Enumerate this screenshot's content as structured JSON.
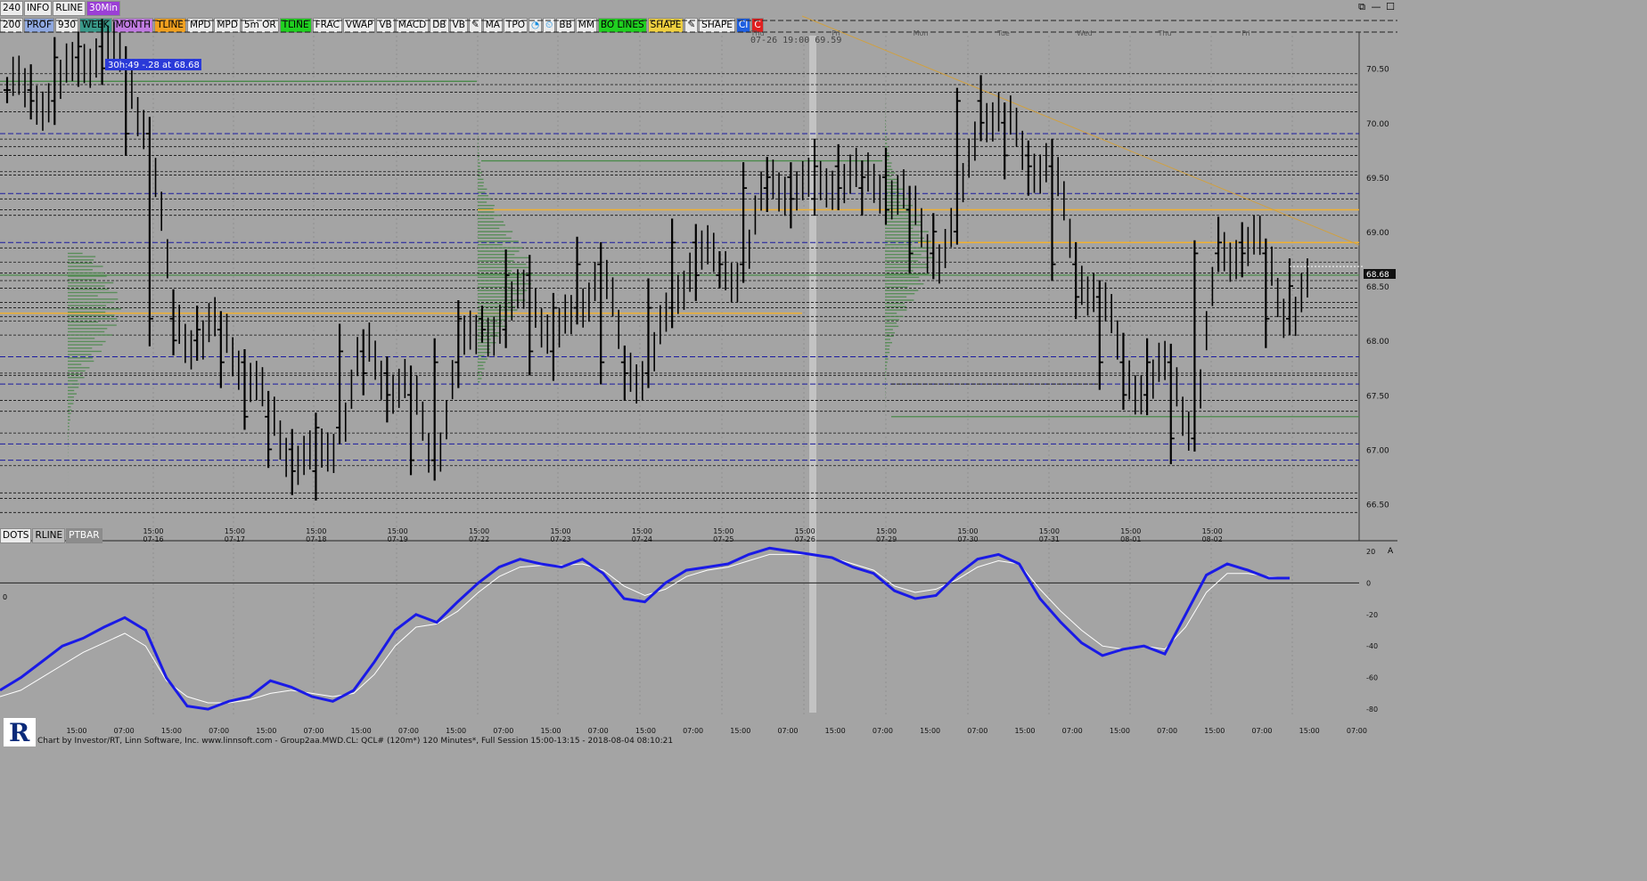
{
  "toolbar": {
    "row1": [
      {
        "label": "240",
        "bg": "#ececec",
        "fg": "#000000"
      },
      {
        "label": "INFO",
        "bg": "#ececec",
        "fg": "#000000"
      },
      {
        "label": "RLINE",
        "bg": "#ececec",
        "fg": "#000000"
      },
      {
        "label": "30Min",
        "bg": "#9b3fd6",
        "fg": "#ffffff"
      }
    ],
    "row2": [
      {
        "label": "200",
        "bg": "#ececec",
        "fg": "#000000"
      },
      {
        "label": "PROF",
        "bg": "#8fa8e0",
        "fg": "#000000"
      },
      {
        "label": "930",
        "bg": "#ececec",
        "fg": "#000000"
      },
      {
        "label": "WEEK",
        "bg": "#3a9a8a",
        "fg": "#000000"
      },
      {
        "label": "MONTH",
        "bg": "#c07be0",
        "fg": "#000000"
      },
      {
        "label": "TLINE",
        "bg": "#f0a020",
        "fg": "#000000"
      },
      {
        "label": "MPD",
        "bg": "#ececec",
        "fg": "#000000"
      },
      {
        "label": "MPD",
        "bg": "#ececec",
        "fg": "#000000"
      },
      {
        "label": "5m OR",
        "bg": "#ececec",
        "fg": "#000000"
      },
      {
        "label": "TLINE",
        "bg": "#20d020",
        "fg": "#000000"
      },
      {
        "label": "FRAC",
        "bg": "#ececec",
        "fg": "#000000"
      },
      {
        "label": "VWAP",
        "bg": "#ececec",
        "fg": "#000000"
      },
      {
        "label": "VB",
        "bg": "#ececec",
        "fg": "#000000"
      },
      {
        "label": "MACD",
        "bg": "#ececec",
        "fg": "#000000"
      },
      {
        "label": "DB",
        "bg": "#ececec",
        "fg": "#000000"
      },
      {
        "label": "VB",
        "bg": "#ececec",
        "fg": "#000000"
      },
      {
        "icon": "pencil-icon",
        "bg": "#ececec",
        "fg": "#000000"
      },
      {
        "label": "MA",
        "bg": "#ececec",
        "fg": "#000000"
      },
      {
        "label": "TPO",
        "bg": "#ececec",
        "fg": "#000000"
      },
      {
        "icon": "pie-icon",
        "bg": "#ececec",
        "fg": "#1a8fe0"
      },
      {
        "icon": "clock-icon",
        "bg": "#ececec",
        "fg": "#1a8fe0"
      },
      {
        "label": "BB",
        "bg": "#ececec",
        "fg": "#000000"
      },
      {
        "label": "MM",
        "bg": "#ececec",
        "fg": "#000000"
      },
      {
        "label": "BO LINES",
        "bg": "#20d020",
        "fg": "#000000"
      },
      {
        "label": "SHAPE",
        "bg": "#f0d040",
        "fg": "#000000"
      },
      {
        "icon": "pencil-icon",
        "bg": "#ececec",
        "fg": "#000000"
      },
      {
        "label": "SHAPE",
        "bg": "#ececec",
        "fg": "#000000"
      },
      {
        "label": "CI",
        "bg": "#2060e0",
        "fg": "#ffffff"
      },
      {
        "label": "C",
        "bg": "#e02020",
        "fg": "#ffffff"
      }
    ]
  },
  "lower_tabs": [
    "DOTS",
    "RLINE",
    "PTBAR"
  ],
  "cursor_readout": "07-26 19:00 69.59",
  "info_label": "30h:49  -.28 at 68.68",
  "last_price": "68.68",
  "weekday_labels": [
    "Thu",
    "Fri",
    "Mon",
    "Tue",
    "Wed",
    "Thu",
    "Fri"
  ],
  "status_text": "Chart by Investor/RT, Linn Software, Inc. www.linnsoft.com - Group2aa.MWD.CL: QCL# (120m*) 120 Minutes*, Full Session 15:00-13:15 - 2018-08-04 08:10:21",
  "right_marker": "A",
  "left_marker": "0",
  "colors": {
    "background": "#a4a4a4",
    "price_bars": "#000000",
    "volume_profile": "#4a8a4a",
    "blue_levels": "#1a1aa0",
    "orange_levels": "#f0b030",
    "indicator_main": "#1a1ae6",
    "indicator_signal": "#ffffff"
  },
  "chart_data": [
    {
      "type": "bar",
      "title": "",
      "ylim": [
        66.3,
        70.8
      ],
      "yticks": [
        "70.50",
        "70.00",
        "69.50",
        "69.00",
        "68.50",
        "68.00",
        "67.50",
        "67.00",
        "66.50"
      ],
      "ytick_values": [
        70.5,
        70.0,
        69.5,
        69.0,
        68.5,
        68.0,
        67.5,
        67.0,
        66.5
      ],
      "xticks": [
        {
          "time": "15:00",
          "date": "07-16"
        },
        {
          "time": "15:00",
          "date": "07-17"
        },
        {
          "time": "15:00",
          "date": "07-18"
        },
        {
          "time": "15:00",
          "date": "07-19"
        },
        {
          "time": "15:00",
          "date": "07-22"
        },
        {
          "time": "15:00",
          "date": "07-23"
        },
        {
          "time": "15:00",
          "date": "07-24"
        },
        {
          "time": "15:00",
          "date": "07-25"
        },
        {
          "time": "15:00",
          "date": "07-26"
        },
        {
          "time": "15:00",
          "date": "07-29"
        },
        {
          "time": "15:00",
          "date": "07-30"
        },
        {
          "time": "15:00",
          "date": "07-31"
        },
        {
          "time": "15:00",
          "date": "08-01"
        },
        {
          "time": "15:00",
          "date": "08-02"
        }
      ],
      "close_series": [
        70.3,
        70.2,
        70.6,
        70.7,
        70.5,
        69.9,
        68.2,
        68.0,
        68.1,
        67.8,
        67.3,
        67.0,
        66.8,
        67.2,
        67.9,
        67.7,
        67.5,
        66.9,
        67.8,
        68.2,
        68.1,
        68.6,
        67.9,
        68.3,
        68.7,
        67.8,
        67.7,
        68.3,
        68.9,
        68.6,
        68.7,
        69.4,
        69.5,
        69.3,
        69.6,
        69.4,
        69.5,
        69.2,
        68.8,
        69.0,
        70.2,
        70.0,
        69.7,
        69.6,
        68.7,
        68.4,
        67.8,
        67.5,
        67.8,
        67.1,
        68.8,
        68.9,
        68.8,
        68.2,
        68.5
      ],
      "levels_blue": [
        69.9,
        69.35,
        68.9,
        67.85,
        67.6,
        67.05,
        66.9
      ],
      "levels_orange": [
        69.2,
        68.9,
        68.25
      ]
    },
    {
      "type": "line",
      "title": "",
      "ylim": [
        -85,
        25
      ],
      "yticks": [
        "20",
        "0",
        "-20",
        "-40",
        "-60",
        "-80"
      ],
      "ytick_values": [
        20,
        0,
        -20,
        -40,
        -60,
        -80
      ],
      "xticks": [
        "15:00",
        "07:00",
        "15:00",
        "07:00",
        "15:00",
        "07:00",
        "15:00",
        "07:00",
        "15:00",
        "07:00",
        "15:00",
        "07:00",
        "15:00",
        "07:00",
        "15:00",
        "07:00",
        "15:00",
        "07:00",
        "15:00",
        "07:00",
        "15:00",
        "07:00",
        "15:00",
        "07:00",
        "15:00",
        "07:00",
        "15:00",
        "07:00"
      ],
      "series": [
        {
          "values": [
            -68,
            -60,
            -50,
            -40,
            -35,
            -28,
            -22,
            -30,
            -60,
            -78,
            -80,
            -75,
            -72,
            -62,
            -66,
            -72,
            -75,
            -68,
            -50,
            -30,
            -20,
            -25,
            -12,
            0,
            10,
            15,
            12,
            10,
            15,
            6,
            -10,
            -12,
            0,
            8,
            10,
            12,
            18,
            22,
            20,
            18,
            16,
            10,
            6,
            -5,
            -10,
            -8,
            5,
            15,
            18,
            12,
            -10,
            -25,
            -38,
            -46,
            -42,
            -40,
            -45,
            -20,
            5,
            12,
            8,
            3,
            3
          ]
        },
        {
          "values": [
            -72,
            -68,
            -60,
            -52,
            -44,
            -38,
            -32,
            -40,
            -62,
            -72,
            -76,
            -76,
            -74,
            -70,
            -68,
            -70,
            -72,
            -70,
            -58,
            -40,
            -28,
            -26,
            -18,
            -6,
            4,
            10,
            11,
            11,
            12,
            8,
            -2,
            -8,
            -4,
            4,
            8,
            10,
            14,
            18,
            18,
            18,
            16,
            12,
            8,
            -2,
            -6,
            -4,
            2,
            10,
            14,
            12,
            -4,
            -18,
            -30,
            -40,
            -42,
            -40,
            -42,
            -28,
            -6,
            6,
            6,
            4,
            3
          ]
        }
      ]
    }
  ]
}
